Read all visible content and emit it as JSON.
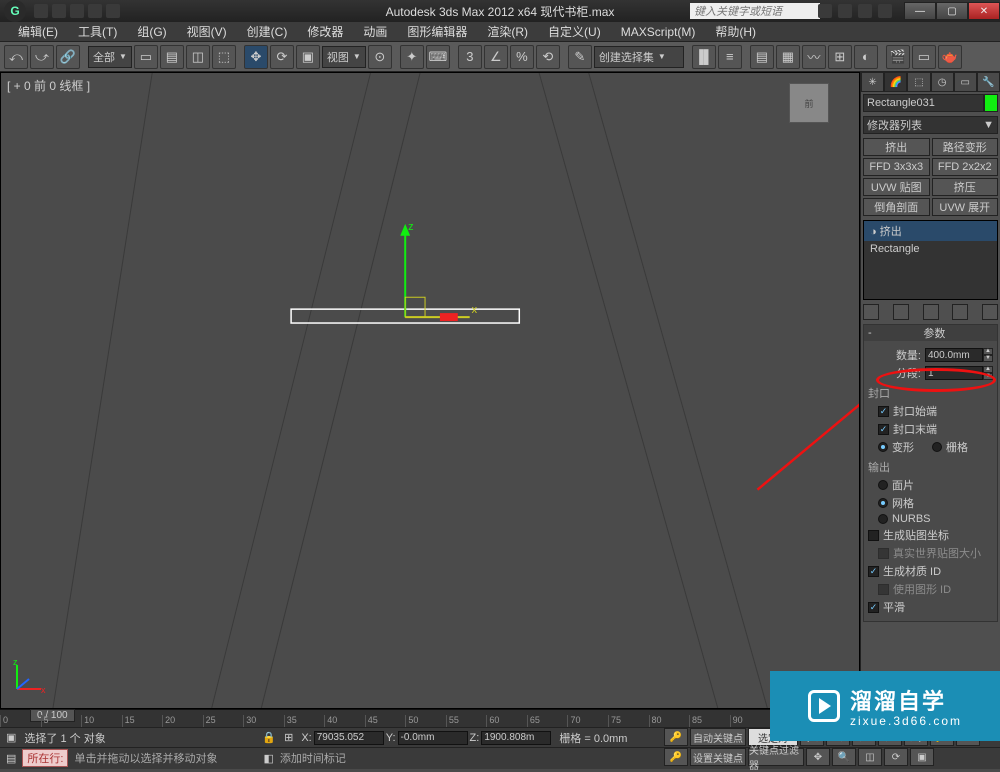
{
  "titlebar": {
    "title": "Autodesk 3ds Max  2012 x64      现代书柜.max",
    "search_placeholder": "键入关键字或短语"
  },
  "menubar": {
    "items": [
      "编辑(E)",
      "工具(T)",
      "组(G)",
      "视图(V)",
      "创建(C)",
      "修改器",
      "动画",
      "图形编辑器",
      "渲染(R)",
      "自定义(U)",
      "MAXScript(M)",
      "帮助(H)"
    ]
  },
  "toolbar": {
    "all_label": "全部",
    "view_label": "视图",
    "selset_label": "创建选择集"
  },
  "viewport": {
    "label": "[ + 0 前 0 线框 ]",
    "viewcube": "前"
  },
  "command_panel": {
    "object_name": "Rectangle031",
    "modifier_list_label": "修改器列表",
    "buttons": [
      "挤出",
      "路径变形",
      "FFD 3x3x3",
      "FFD 2x2x2",
      "UVW 贴图",
      "挤压",
      "倒角剖面",
      "UVW 展开"
    ],
    "stack": [
      {
        "label": "挤出",
        "selected": true,
        "icon": "◑"
      },
      {
        "label": "Rectangle",
        "selected": false,
        "icon": ""
      }
    ],
    "rollout_title": "参数",
    "params": {
      "amount_label": "数量:",
      "amount_value": "400.0mm",
      "segments_label": "分段:",
      "segments_value": "1"
    },
    "cap_group": "封口",
    "cap_start": "封口始端",
    "cap_end": "封口末端",
    "cap_morph": "变形",
    "cap_grid": "栅格",
    "output_group": "输出",
    "out_patch": "面片",
    "out_mesh": "网格",
    "out_nurbs": "NURBS",
    "gen_map": "生成贴图坐标",
    "real_world": "真实世界贴图大小",
    "gen_mat": "生成材质 ID",
    "use_shape": "使用图形 ID",
    "smooth": "平滑"
  },
  "status": {
    "frame": "0 / 100",
    "ticks": [
      "0",
      "5",
      "10",
      "15",
      "20",
      "25",
      "30",
      "35",
      "40",
      "45",
      "50",
      "55",
      "60",
      "65",
      "70",
      "75",
      "80",
      "85",
      "90"
    ],
    "selected_msg": "选择了 1 个 对象",
    "x_label": "X:",
    "x_val": "79035.052",
    "y_label": "Y:",
    "y_val": "-0.0mm",
    "z_label": "Z:",
    "z_val": "1900.808m",
    "grid_label": "栅格 = 0.0mm",
    "autokey": "自动关键点",
    "setkey": "设置关键点",
    "selected_dd": "选定对",
    "keyfilter": "关键点过滤器",
    "script_label": "所在行:",
    "hint": "单击并拖动以选择并移动对象",
    "add_time": "添加时间标记"
  },
  "watermark": {
    "brand": "溜溜自学",
    "url": "zixue.3d66.com"
  }
}
